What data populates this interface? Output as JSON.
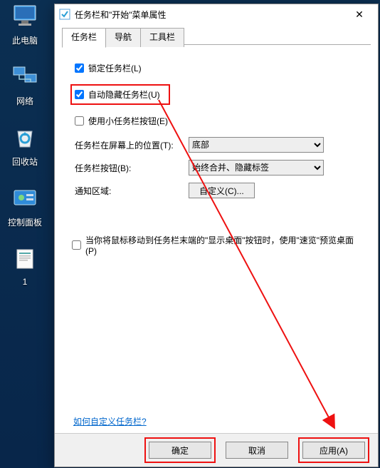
{
  "desktop": {
    "icons": [
      {
        "name": "this-pc",
        "label": "此电脑"
      },
      {
        "name": "network",
        "label": "网络"
      },
      {
        "name": "recycle-bin",
        "label": "回收站"
      },
      {
        "name": "control-panel",
        "label": "控制面板"
      },
      {
        "name": "file-1",
        "label": "1"
      }
    ]
  },
  "dialog": {
    "title": "任务栏和\"开始\"菜单属性",
    "tabs": [
      {
        "key": "taskbar",
        "label": "任务栏"
      },
      {
        "key": "nav",
        "label": "导航"
      },
      {
        "key": "toolbar",
        "label": "工具栏"
      }
    ],
    "activeTab": "taskbar",
    "checks": {
      "lock": {
        "label": "锁定任务栏(L)",
        "checked": true
      },
      "autohide": {
        "label": "自动隐藏任务栏(U)",
        "checked": true
      },
      "smallbuttons": {
        "label": "使用小任务栏按钮(E)",
        "checked": false
      },
      "peek": {
        "label": "当你将鼠标移动到任务栏末端的\"显示桌面\"按钮时，使用\"速览\"预览桌面(P)",
        "checked": false
      }
    },
    "position": {
      "label": "任务栏在屏幕上的位置(T):",
      "value": "底部"
    },
    "buttons": {
      "label": "任务栏按钮(B):",
      "value": "始终合并、隐藏标签"
    },
    "notify": {
      "label": "通知区域:",
      "button": "自定义(C)..."
    },
    "help": "如何自定义任务栏?",
    "actions": {
      "ok": "确定",
      "cancel": "取消",
      "apply": "应用(A)"
    }
  }
}
